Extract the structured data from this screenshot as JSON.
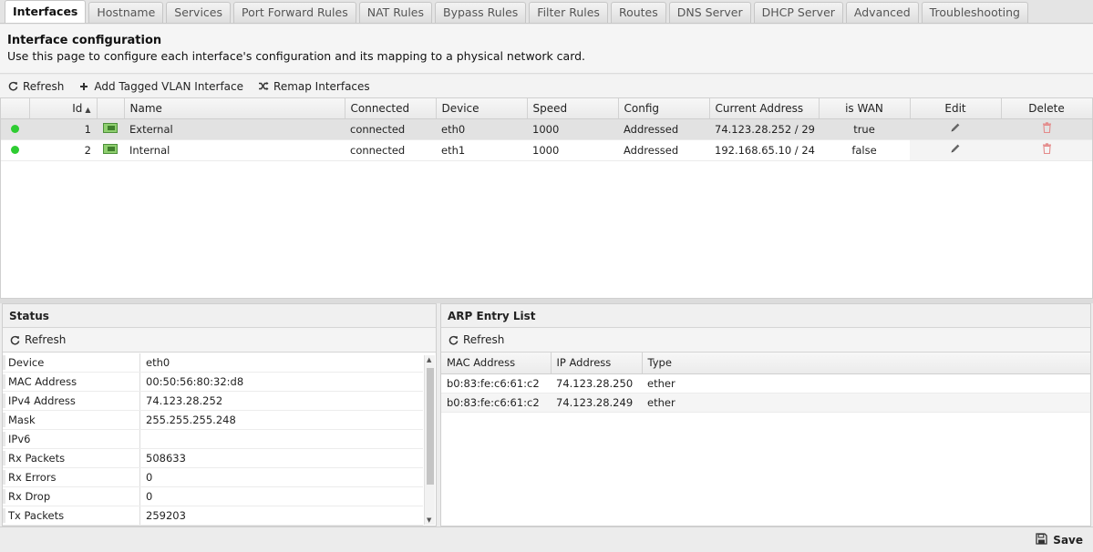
{
  "tabs": [
    {
      "label": "Interfaces",
      "active": true
    },
    {
      "label": "Hostname"
    },
    {
      "label": "Services"
    },
    {
      "label": "Port Forward Rules"
    },
    {
      "label": "NAT Rules"
    },
    {
      "label": "Bypass Rules"
    },
    {
      "label": "Filter Rules"
    },
    {
      "label": "Routes"
    },
    {
      "label": "DNS Server"
    },
    {
      "label": "DHCP Server"
    },
    {
      "label": "Advanced"
    },
    {
      "label": "Troubleshooting"
    }
  ],
  "header": {
    "title": "Interface configuration",
    "description": "Use this page to configure each interface's configuration and its mapping to a physical network card."
  },
  "toolbar": {
    "refresh": "Refresh",
    "add_vlan": "Add Tagged VLAN Interface",
    "remap": "Remap Interfaces"
  },
  "interfaces": {
    "columns": [
      "",
      "Id",
      "",
      "Name",
      "Connected",
      "Device",
      "Speed",
      "Config",
      "Current Address",
      "is WAN",
      "Edit",
      "Delete"
    ],
    "rows": [
      {
        "id": "1",
        "name": "External",
        "connected": "connected",
        "device": "eth0",
        "speed": "1000",
        "config": "Addressed",
        "address": "74.123.28.252 / 29",
        "is_wan": "true"
      },
      {
        "id": "2",
        "name": "Internal",
        "connected": "connected",
        "device": "eth1",
        "speed": "1000",
        "config": "Addressed",
        "address": "192.168.65.10 / 24",
        "is_wan": "false"
      }
    ]
  },
  "status": {
    "title": "Status",
    "refresh": "Refresh",
    "rows": [
      {
        "key": "Device",
        "value": "eth0"
      },
      {
        "key": "MAC Address",
        "value": "00:50:56:80:32:d8"
      },
      {
        "key": "IPv4 Address",
        "value": "74.123.28.252"
      },
      {
        "key": "Mask",
        "value": "255.255.255.248"
      },
      {
        "key": "IPv6",
        "value": ""
      },
      {
        "key": "Rx Packets",
        "value": "508633"
      },
      {
        "key": "Rx Errors",
        "value": "0"
      },
      {
        "key": "Rx Drop",
        "value": "0"
      },
      {
        "key": "Tx Packets",
        "value": "259203"
      }
    ]
  },
  "arp": {
    "title": "ARP Entry List",
    "refresh": "Refresh",
    "columns": [
      "MAC Address",
      "IP Address",
      "Type"
    ],
    "rows": [
      {
        "mac": "b0:83:fe:c6:61:c2",
        "ip": "74.123.28.250",
        "type": "ether"
      },
      {
        "mac": "b0:83:fe:c6:61:c2",
        "ip": "74.123.28.249",
        "type": "ether"
      }
    ]
  },
  "footer": {
    "save": "Save"
  },
  "colors": {
    "online_dot": "#2ecc32",
    "delete_icon": "#e48a8a"
  }
}
